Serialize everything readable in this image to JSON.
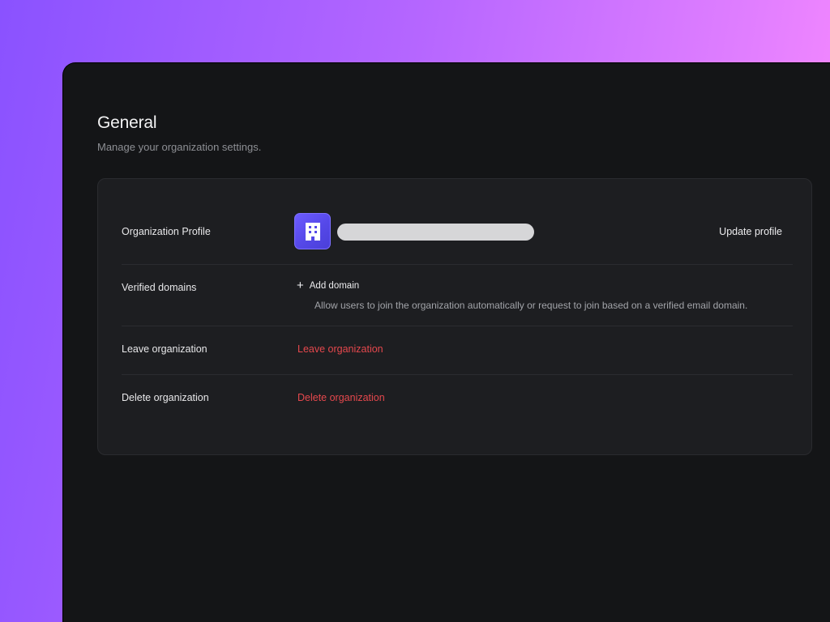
{
  "header": {
    "title": "General",
    "subtitle": "Manage your organization settings."
  },
  "profile": {
    "label": "Organization Profile",
    "logo_icon": "building-icon",
    "update_label": "Update profile"
  },
  "domains": {
    "label": "Verified domains",
    "add_label": "Add domain",
    "description": "Allow users to join the organization automatically or request to join based on a verified email domain."
  },
  "leave": {
    "label": "Leave organization",
    "action_label": "Leave organization"
  },
  "delete": {
    "label": "Delete organization",
    "action_label": "Delete organization"
  },
  "colors": {
    "background_gradient_start": "#8a52ff",
    "background_gradient_end": "#ff8dff",
    "panel": "#141517",
    "card": "#1d1e21",
    "danger": "#e5484d",
    "accent": "#5548e8"
  }
}
